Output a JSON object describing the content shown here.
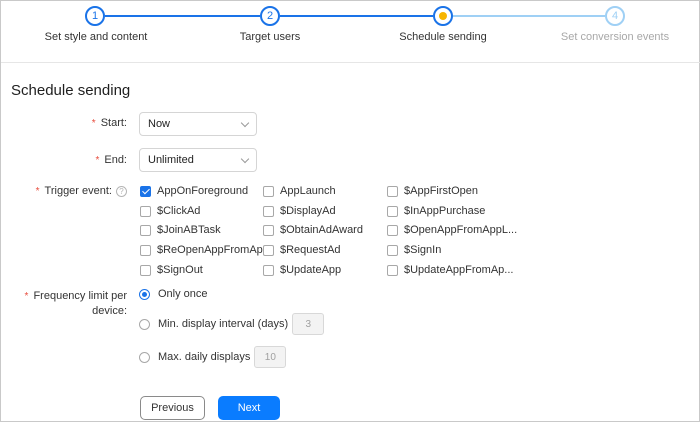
{
  "steps": [
    {
      "number": "1",
      "label": "Set style and content",
      "state": "done"
    },
    {
      "number": "2",
      "label": "Target users",
      "state": "done"
    },
    {
      "number": "",
      "label": "Schedule sending",
      "state": "current"
    },
    {
      "number": "4",
      "label": "Set conversion events",
      "state": "todo"
    }
  ],
  "section_title": "Schedule sending",
  "form": {
    "start": {
      "label": "Start:",
      "value": "Now"
    },
    "end": {
      "label": "End:",
      "value": "Unlimited"
    },
    "trigger": {
      "label": "Trigger event:",
      "help": "?",
      "events": [
        {
          "label": "AppOnForeground",
          "checked": true
        },
        {
          "label": "AppLaunch",
          "checked": false
        },
        {
          "label": "$AppFirstOpen",
          "checked": false
        },
        {
          "label": "$ClickAd",
          "checked": false
        },
        {
          "label": "$DisplayAd",
          "checked": false
        },
        {
          "label": "$InAppPurchase",
          "checked": false
        },
        {
          "label": "$JoinABTask",
          "checked": false
        },
        {
          "label": "$ObtainAdAward",
          "checked": false
        },
        {
          "label": "$OpenAppFromAppL...",
          "checked": false
        },
        {
          "label": "$ReOpenAppFromAp...",
          "checked": false
        },
        {
          "label": "$RequestAd",
          "checked": false
        },
        {
          "label": "$SignIn",
          "checked": false
        },
        {
          "label": "$SignOut",
          "checked": false
        },
        {
          "label": "$UpdateApp",
          "checked": false
        },
        {
          "label": "$UpdateAppFromAp...",
          "checked": false
        }
      ]
    },
    "frequency": {
      "label_line1": "Frequency limit per",
      "label_line2": "device:",
      "options": [
        {
          "label": "Only once",
          "checked": true
        },
        {
          "label": "Min. display interval (days)",
          "checked": false,
          "value": "3"
        },
        {
          "label": "Max. daily displays",
          "checked": false,
          "value": "10"
        }
      ]
    }
  },
  "buttons": {
    "previous": "Previous",
    "next": "Next"
  },
  "colors": {
    "primary": "#1a73e8",
    "current_dot": "#f7b500",
    "required": "#e84b3c",
    "next_button": "#0a7cff"
  }
}
